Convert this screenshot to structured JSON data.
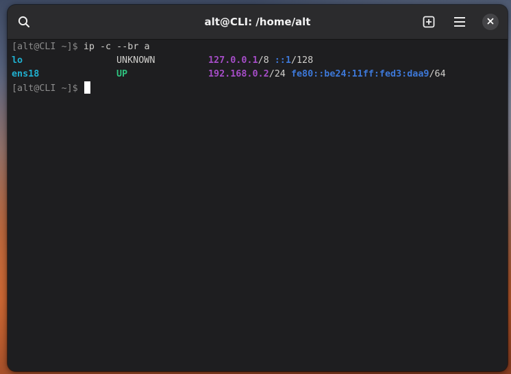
{
  "window": {
    "title": "alt@CLI: /home/alt",
    "icons": {
      "search": "search-icon",
      "new_tab": "new-tab-icon",
      "menu": "hamburger-menu-icon",
      "close": "close-icon"
    }
  },
  "terminal": {
    "line1": {
      "prompt": "[alt@CLI ~]$ ",
      "command": "ip -c --br a"
    },
    "rows": [
      {
        "iface": "lo",
        "state": "UNKNOWN",
        "ipv4_addr": "127.0.0.1",
        "ipv4_mask": "/8",
        "ipv6_addr": "::1",
        "ipv6_mask": "/128"
      },
      {
        "iface": "ens18",
        "state": "UP",
        "ipv4_addr": "192.168.0.2",
        "ipv4_mask": "/24",
        "ipv6_addr": "fe80::be24:11ff:fed3:daa9",
        "ipv6_mask": "/64"
      }
    ],
    "line4": {
      "prompt": "[alt@CLI ~]$ "
    }
  },
  "colors": {
    "headerbar": "#2b2b2d",
    "terminal_bg": "#1e1e20",
    "prompt": "#8c8c8c",
    "iface": "#20b0d0",
    "state_up": "#2ec27e",
    "ipv4": "#a64dc8",
    "ipv6": "#3d78d8",
    "text": "#d0cfcc"
  }
}
